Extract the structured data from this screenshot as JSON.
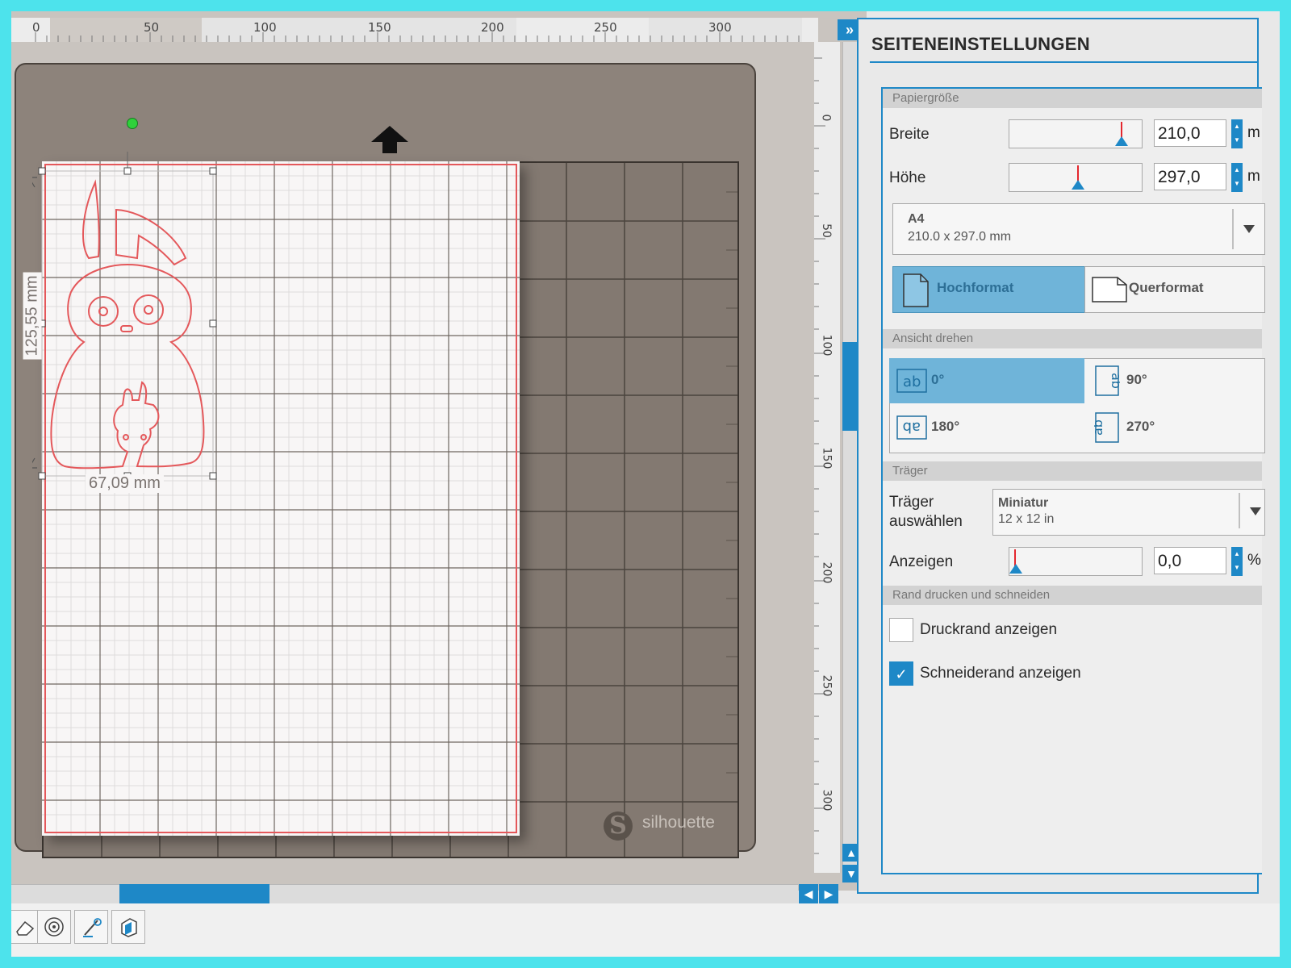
{
  "canvas": {
    "ruler_h_labels": [
      "0",
      "50",
      "100",
      "150",
      "200",
      "250",
      "300"
    ],
    "ruler_v_labels": [
      "0",
      "50",
      "100",
      "150",
      "200",
      "250",
      "300"
    ],
    "width_dimension": "67,09 mm",
    "height_dimension": "125,55 mm",
    "brand_text": "silhouette",
    "brand_mark": "S",
    "expand_glyph": "»",
    "scroll_up_glyph": "▲",
    "scroll_down_glyph": "▼",
    "scroll_left_glyph": "◀",
    "scroll_right_glyph": "▶"
  },
  "panel": {
    "title": "SEITENEINSTELLUNGEN",
    "paper_size": {
      "section_label": "Papiergröße",
      "width_label": "Breite",
      "width_value": "210,0",
      "width_unit": "m",
      "height_label": "Höhe",
      "height_value": "297,0",
      "height_unit": "m",
      "preset_name": "A4",
      "preset_size": "210.0 x 297.0 mm",
      "portrait_label": "Hochformat",
      "landscape_label": "Querformat"
    },
    "rotate_view": {
      "section_label": "Ansicht drehen",
      "options": [
        "0°",
        "90°",
        "180°",
        "270°"
      ],
      "selected": "0°"
    },
    "carrier": {
      "section_label": "Träger",
      "select_label_line1": "Träger",
      "select_label_line2": "auswählen",
      "carrier_name": "Miniatur",
      "carrier_size": "12 x 12 in",
      "show_label": "Anzeigen",
      "show_value": "0,0",
      "show_unit": "%"
    },
    "border": {
      "section_label": "Rand drucken und schneiden",
      "print_border_label": "Druckrand anzeigen",
      "print_border_checked": false,
      "cut_border_label": "Schneiderand anzeigen",
      "cut_border_checked": true,
      "check_glyph": "✓"
    }
  },
  "colors": {
    "accent": "#1e88c7",
    "mat": "#8d837b",
    "cut_line": "#e4585b",
    "background": "#4de3ec"
  }
}
